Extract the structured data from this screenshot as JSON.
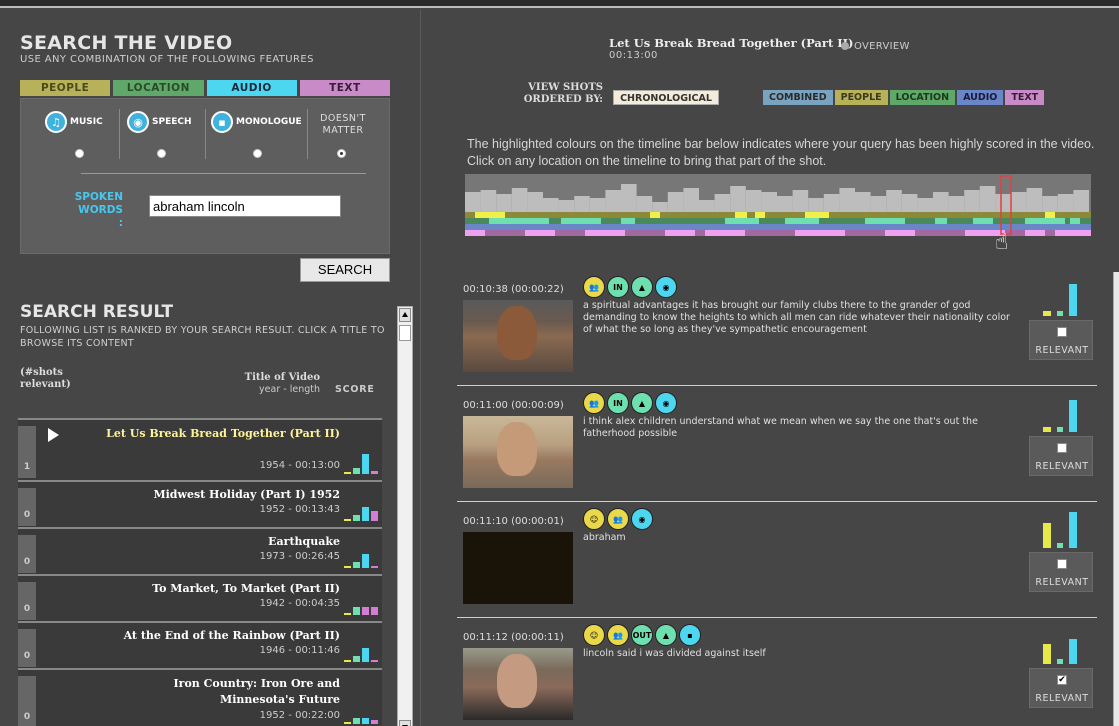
{
  "search": {
    "title": "SEARCH THE VIDEO",
    "subtitle": "USE ANY COMBINATION OF THE FOLLOWING FEATURES",
    "tabs": [
      {
        "label": "PEOPLE",
        "bg": "#b7b25a",
        "fg": "#4a4a1a"
      },
      {
        "label": "LOCATION",
        "bg": "#5fa86a",
        "fg": "#2a4a2a"
      },
      {
        "label": "AUDIO",
        "bg": "#4dd6f0",
        "fg": "#1a2a3a"
      },
      {
        "label": "TEXT",
        "bg": "#c88bc8",
        "fg": "#3a1a3a"
      }
    ],
    "options": {
      "music": "MUSIC",
      "speech": "SPEECH",
      "monologue": "MONOLOGUE",
      "doesnt_matter": "DOESN'T MATTER"
    },
    "spoken_label": "SPOKEN WORDS :",
    "spoken_value": "abraham lincoln",
    "search_button": "SEARCH"
  },
  "results": {
    "title": "SEARCH RESULT",
    "subtitle": "FOLLOWING LIST IS RANKED BY YOUR SEARCH RESULT. CLICK A TITLE TO BROWSE ITS CONTENT",
    "col_shots": "(#shots relevant)",
    "col_title": "Title of Video",
    "col_meta": "year - length",
    "col_score": "SCORE",
    "items": [
      {
        "rank": "1",
        "title": "Let Us Break Bread Together (Part II)",
        "meta": "1954 - 00:13:00",
        "selected": true
      },
      {
        "rank": "0",
        "title": "Midwest Holiday (Part I) 1952",
        "meta": "1952 - 00:13:43"
      },
      {
        "rank": "0",
        "title": "Earthquake",
        "meta": "1973 - 00:26:45"
      },
      {
        "rank": "0",
        "title": "To Market, To Market (Part II)",
        "meta": "1942 - 00:04:35"
      },
      {
        "rank": "0",
        "title": "At the End of the Rainbow (Part II)",
        "meta": "1946 - 00:11:46"
      },
      {
        "rank": "0",
        "title": "Iron Country: Iron Ore and Minnesota's Future",
        "meta": "1952 - 00:22:00"
      }
    ]
  },
  "viewer": {
    "video_title": "Let Us Break Bread Together (Part II)",
    "video_length": "00:13:00",
    "overview": "OVERVIEW",
    "order_label": "VIEW SHOTS ORDERED BY:",
    "order_value": "CHRONOLOGICAL",
    "sort_tabs": [
      {
        "label": "COMBINED",
        "bg": "#7aa3c0",
        "fg": "#2a2a2a"
      },
      {
        "label": "PEOPLE",
        "bg": "#b7b25a",
        "fg": "#3a3a1a"
      },
      {
        "label": "LOCATION",
        "bg": "#5fa86a",
        "fg": "#1a3a1a"
      },
      {
        "label": "AUDIO",
        "bg": "#6a86c8",
        "fg": "#1a1a3a"
      },
      {
        "label": "TEXT",
        "bg": "#c88bc8",
        "fg": "#3a1a3a"
      }
    ],
    "hint": "The highlighted colours on the timeline bar below indicates where your query has been highly scored in the video. Click on any location on the timeline to bring that part of the shot.",
    "relevant_label": "RELEVANT",
    "shots": [
      {
        "tc": "00:10:38 (00:00:22)",
        "icons": [
          "people",
          "in",
          "landscape",
          "speech"
        ],
        "text": "a spiritual advantages it has brought our family clubs there to the grander of god demanding to know the heights to which all men can ride whatever their nationality color of what the so long as they've sympathetic encouragement",
        "checked": false,
        "thumb": "woman1",
        "b": [
          0.15,
          0.15,
          0.9
        ]
      },
      {
        "tc": "00:11:00 (00:00:09)",
        "icons": [
          "people",
          "in",
          "landscape",
          "speech"
        ],
        "text": "i think alex children understand what we mean when we say the one that's out the fatherhood possible",
        "checked": false,
        "thumb": "woman2",
        "b": [
          0.15,
          0.15,
          0.9
        ]
      },
      {
        "tc": "00:11:10 (00:00:01)",
        "icons": [
          "smile",
          "people",
          "speech"
        ],
        "text": "abraham",
        "checked": false,
        "thumb": "black",
        "b": [
          0.7,
          0.15,
          1.0
        ]
      },
      {
        "tc": "00:11:12 (00:00:11)",
        "icons": [
          "smile",
          "people",
          "out",
          "landscape",
          "mono"
        ],
        "text": "lincoln said i was divided against itself",
        "checked": true,
        "thumb": "lincoln",
        "b": [
          0.55,
          0.15,
          0.7
        ]
      }
    ]
  }
}
